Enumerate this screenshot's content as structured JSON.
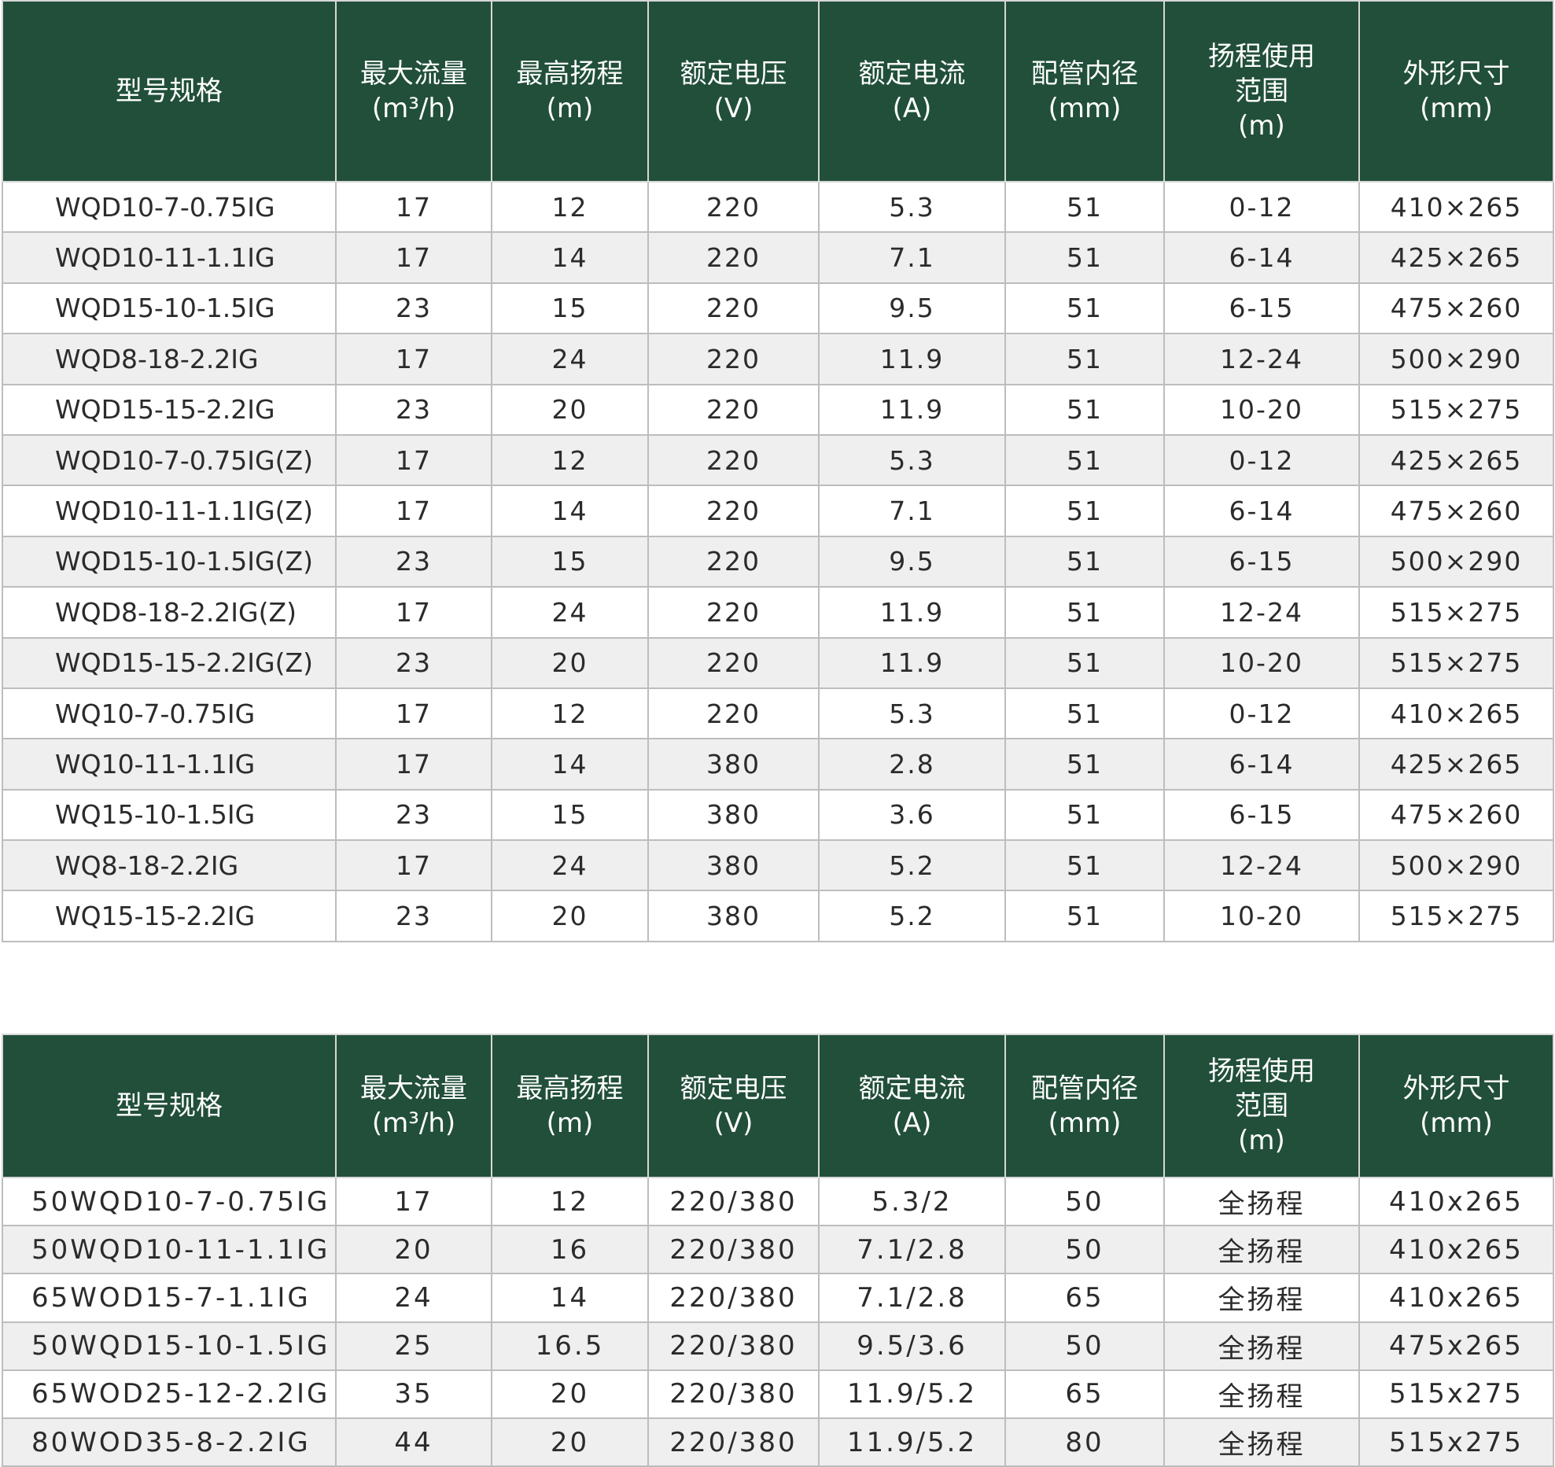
{
  "table1": {
    "headers": [
      [
        "型号规格"
      ],
      [
        "最大流量",
        "(m³/h)"
      ],
      [
        "最高扬程",
        "(m)"
      ],
      [
        "额定电压",
        "(V)"
      ],
      [
        "额定电流",
        "(A)"
      ],
      [
        "配管内径",
        "(mm)"
      ],
      [
        "扬程使用",
        "范围",
        "(m)"
      ],
      [
        "外形尺寸",
        "(mm)"
      ]
    ],
    "rows": [
      [
        "WQD10-7-0.75IG",
        "17",
        "12",
        "220",
        "5.3",
        "51",
        "0-12",
        "410×265"
      ],
      [
        "WQD10-11-1.1IG",
        "17",
        "14",
        "220",
        "7.1",
        "51",
        "6-14",
        "425×265"
      ],
      [
        "WQD15-10-1.5IG",
        "23",
        "15",
        "220",
        "9.5",
        "51",
        "6-15",
        "475×260"
      ],
      [
        "WQD8-18-2.2IG",
        "17",
        "24",
        "220",
        "11.9",
        "51",
        "12-24",
        "500×290"
      ],
      [
        "WQD15-15-2.2IG",
        "23",
        "20",
        "220",
        "11.9",
        "51",
        "10-20",
        "515×275"
      ],
      [
        "WQD10-7-0.75IG(Z)",
        "17",
        "12",
        "220",
        "5.3",
        "51",
        "0-12",
        "425×265"
      ],
      [
        "WQD10-11-1.1IG(Z)",
        "17",
        "14",
        "220",
        "7.1",
        "51",
        "6-14",
        "475×260"
      ],
      [
        "WQD15-10-1.5IG(Z)",
        "23",
        "15",
        "220",
        "9.5",
        "51",
        "6-15",
        "500×290"
      ],
      [
        "WQD8-18-2.2IG(Z)",
        "17",
        "24",
        "220",
        "11.9",
        "51",
        "12-24",
        "515×275"
      ],
      [
        "WQD15-15-2.2IG(Z)",
        "23",
        "20",
        "220",
        "11.9",
        "51",
        "10-20",
        "515×275"
      ],
      [
        "WQ10-7-0.75IG",
        "17",
        "12",
        "220",
        "5.3",
        "51",
        "0-12",
        "410×265"
      ],
      [
        "WQ10-11-1.1IG",
        "17",
        "14",
        "380",
        "2.8",
        "51",
        "6-14",
        "425×265"
      ],
      [
        "WQ15-10-1.5IG",
        "23",
        "15",
        "380",
        "3.6",
        "51",
        "6-15",
        "475×260"
      ],
      [
        "WQ8-18-2.2IG",
        "17",
        "24",
        "380",
        "5.2",
        "51",
        "12-24",
        "500×290"
      ],
      [
        "WQ15-15-2.2IG",
        "23",
        "20",
        "380",
        "5.2",
        "51",
        "10-20",
        "515×275"
      ]
    ]
  },
  "table2": {
    "headers": [
      [
        "型号规格"
      ],
      [
        "最大流量",
        "(m³/h)"
      ],
      [
        "最高扬程",
        "(m)"
      ],
      [
        "额定电压",
        "(V)"
      ],
      [
        "额定电流",
        "(A)"
      ],
      [
        "配管内径",
        "(mm)"
      ],
      [
        "扬程使用",
        "范围",
        "(m)"
      ],
      [
        "外形尺寸",
        "(mm)"
      ]
    ],
    "rows": [
      [
        "50WQD10-7-0.75IG",
        "17",
        "12",
        "220/380",
        "5.3/2",
        "50",
        "全扬程",
        "410x265"
      ],
      [
        "50WQD10-11-1.1IG",
        "20",
        "16",
        "220/380",
        "7.1/2.8",
        "50",
        "全扬程",
        "410x265"
      ],
      [
        "65WOD15-7-1.1IG",
        "24",
        "14",
        "220/380",
        "7.1/2.8",
        "65",
        "全扬程",
        "410x265"
      ],
      [
        "50WQD15-10-1.5IG",
        "25",
        "16.5",
        "220/380",
        "9.5/3.6",
        "50",
        "全扬程",
        "475x265"
      ],
      [
        "65WOD25-12-2.2IG",
        "35",
        "20",
        "220/380",
        "11.9/5.2",
        "65",
        "全扬程",
        "515x275"
      ],
      [
        "80WOD35-8-2.2IG",
        "44",
        "20",
        "220/380",
        "11.9/5.2",
        "80",
        "全扬程",
        "515x275"
      ]
    ]
  }
}
